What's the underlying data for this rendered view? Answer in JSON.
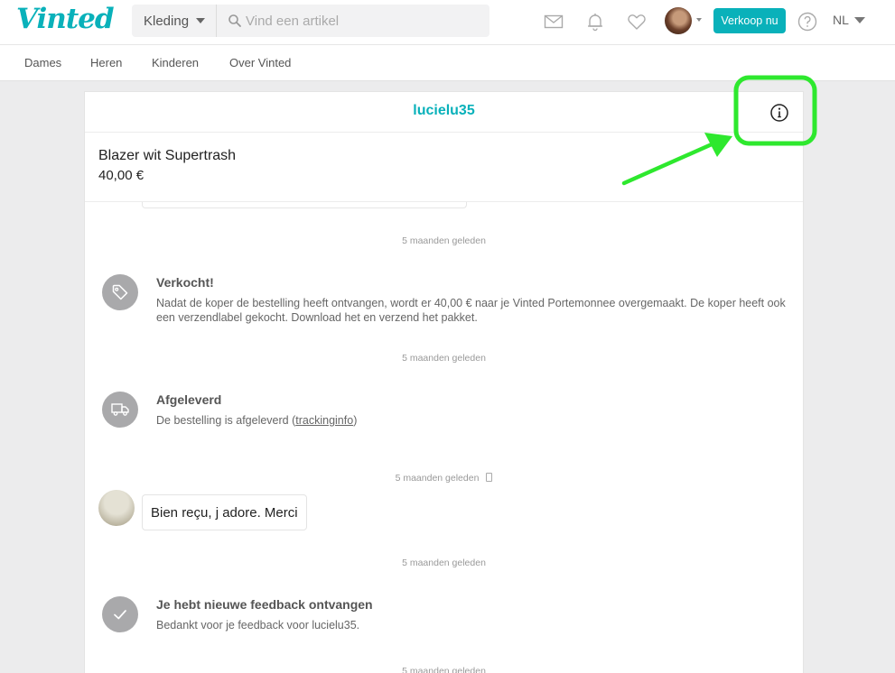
{
  "header": {
    "logo": "Vinted",
    "category_select": "Kleding",
    "search_placeholder": "Vind een artikel",
    "sell_button": "Verkoop nu",
    "language": "NL"
  },
  "nav": {
    "items": [
      "Dames",
      "Heren",
      "Kinderen",
      "Over Vinted"
    ]
  },
  "conversation": {
    "username": "lucielu35",
    "item_title": "Blazer wit Supertrash",
    "item_price": "40,00 €",
    "events": [
      {
        "timestamp": "5 maanden geleden",
        "title": "Verkocht!",
        "text": "Nadat de koper de bestelling heeft ontvangen, wordt er 40,00 € naar je Vinted Portemonnee overgemaakt. De koper heeft ook een verzendlabel gekocht. Download het en verzend het pakket.",
        "icon": "tag-icon"
      },
      {
        "timestamp": "5 maanden geleden",
        "title": "Afgeleverd",
        "text_prefix": "De bestelling is afgeleverd (",
        "link": "trackinginfo",
        "text_suffix": ")",
        "icon": "truck-icon"
      },
      {
        "timestamp": "5 maanden geleden",
        "title": "Je hebt nieuwe feedback ontvangen",
        "text": "Bedankt voor je feedback voor lucielu35.",
        "icon": "check-icon"
      }
    ],
    "message": {
      "timestamp": "5 maanden geleden",
      "text": "Bien reçu, j adore. Merci"
    },
    "trailing_timestamp": "5 maanden geleden"
  },
  "colors": {
    "brand": "#09b1ba",
    "annotation": "#2ee82e"
  }
}
